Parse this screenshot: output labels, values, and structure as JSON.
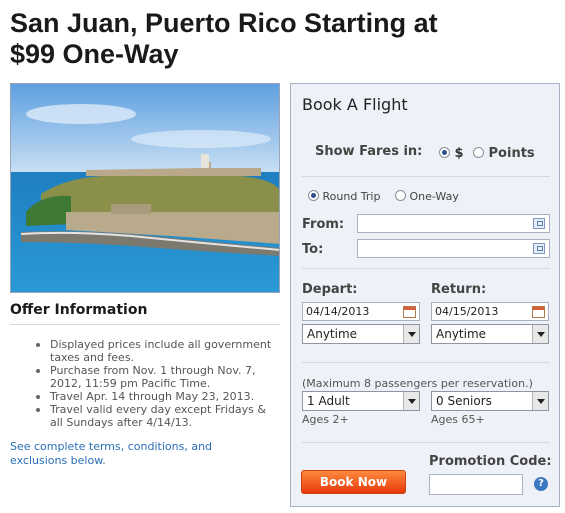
{
  "headline": {
    "line1": "San Juan, Puerto Rico Starting at",
    "line2": "$99 One-Way"
  },
  "photo": {
    "alt": ""
  },
  "offer": {
    "title": "Offer Information",
    "items": [
      "Displayed prices include all government taxes and fees.",
      "Purchase from Nov. 1 through Nov. 7, 2012, 11:59 pm Pacific Time.",
      "Travel Apr. 14 through May 23, 2013.",
      "Travel valid every day except Fridays & all Sundays after 4/14/13."
    ],
    "terms_link": "See complete terms, conditions, and exclusions below."
  },
  "booking": {
    "title": "Book A Flight",
    "show_fares_label": "Show Fares in:",
    "fare_options": [
      {
        "label": "$",
        "selected": true
      },
      {
        "label": "Points",
        "selected": false
      }
    ],
    "trip_options": [
      {
        "label": "Round Trip",
        "selected": true
      },
      {
        "label": "One-Way",
        "selected": false
      }
    ],
    "from_label": "From:",
    "to_label": "To:",
    "depart_label": "Depart:",
    "return_label": "Return:",
    "depart_date": "04/14/2013",
    "return_date": "04/15/2013",
    "depart_time": "Anytime",
    "return_time": "Anytime",
    "max_passengers_note": "(Maximum 8 passengers per reservation.)",
    "adults": "1 Adult",
    "seniors": "0 Seniors",
    "adults_age": "Ages 2+",
    "seniors_age": "Ages 65+",
    "book_button": "Book Now",
    "promo_label": "Promotion Code:",
    "help_glyph": "?"
  },
  "colors": {
    "link": "#2a6fb8",
    "button_top": "#ff8a3d",
    "button_bottom": "#e8380c",
    "panel_bg": "#eef1f7"
  }
}
